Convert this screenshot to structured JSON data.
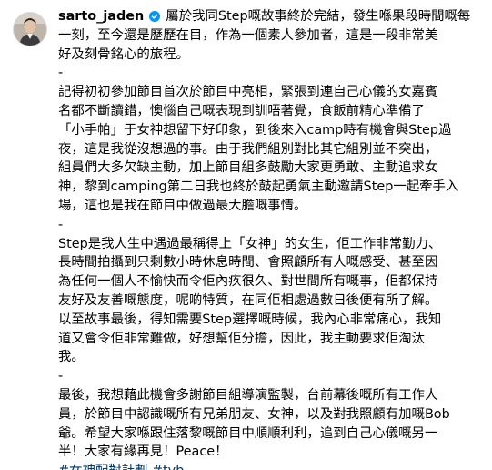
{
  "post": {
    "username": "sarto_jaden",
    "lines": [
      "屬於我同Step嘅故事終於完結，發生喺果段時間嘅每",
      "一刻，至今還是歷歷在目，作為一個素人參加者，這是一段非常美",
      "好及刻骨銘心的旅程。",
      "-",
      "記得初初參加節目首次於節目中亮相，緊張到連自己心儀的女嘉賓",
      "名都不斷讀錯，懊惱自己嘅表現到訓唔著覺，食飯前精心準備了",
      "「小手帕」于女神想留下好印象，到後來入camp時有機會與Step過",
      "夜，這是我從沒想過的事。由于我們組別對比其它組別並不突出，",
      "組員們大多欠缺主動，加上節目組多鼓勵大家更勇敢、主動追求女",
      "神，黎到camping第二日我也終於鼓起勇氣主動邀請Step一起牽手入",
      "場，這也是我在節目中做過最大膽嘅事情。",
      "-",
      "Step是我人生中遇過最稱得上「女神」的女生，佢工作非常勤力、",
      "長時間拍攝到只剩數小時休息時間、會照顧所有人嘅感受、甚至因",
      "為任何一個人不愉快而令佢內疚很久、對世間所有嘅事，佢都保持",
      "友好及友善嘅態度，呢啲特質，在同佢相處過數日後便有所了解。",
      "以至故事最後，得知需要Step選擇嘅時候，我內心非常痛心，我知",
      "道又會令佢非常難做，好想幫佢分擔，因此，我主動要求佢淘汰",
      "我。",
      "-",
      "最後，我想藉此機會多謝節目組導演監製，台前幕後嘅所有工作人",
      "員，於節目中認識嘅所有兄弟朋友、女神，以及對我照顧有加嘅Bob",
      "爺。希望大家喺跟住落黎嘅節目中順順利利，追到自己心儀嘅另一",
      "半！大家有緣再見！Peace！"
    ],
    "hashtags": "#女神配對計劃 #tvb"
  },
  "colors": {
    "text": "#000000",
    "hashtag": "#00376b",
    "verified_badge": "#0095f6",
    "avatar_border": "#dbdbdb"
  },
  "icons": {
    "verified": "verified-badge-icon",
    "avatar": "profile-photo"
  }
}
